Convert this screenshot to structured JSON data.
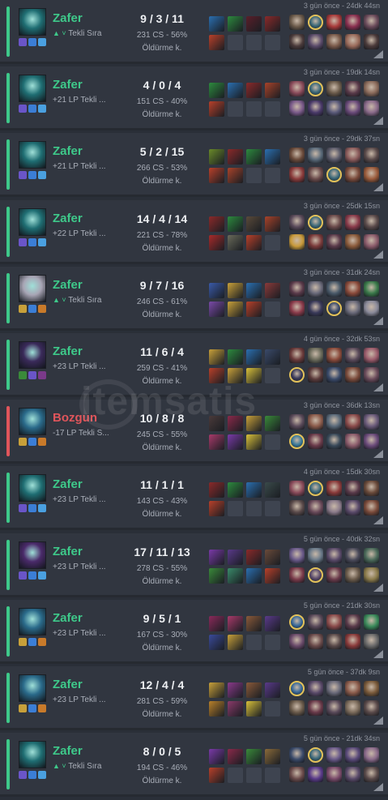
{
  "watermark": "itemsatis",
  "matches": [
    {
      "result": "Zafer",
      "outcome": "win",
      "lp": "Tekli Sıra",
      "lp_arrow": "▲ ˅",
      "kda": "9 / 3 / 11",
      "cs": "231 CS - 56%",
      "kill_streak": "Öldürme k.",
      "time": "3 gün önce - 24dk 44sn",
      "champ_color": "#1f6e73",
      "spells": [
        "#6a55c8",
        "#3b7ed6",
        "#4aa0e0"
      ],
      "items": [
        "#2b6fb0",
        "#2d8a3e",
        "#5a1f2a",
        "#8b2a2a",
        "#b8402a",
        "",
        "",
        ""
      ],
      "team": [
        "#6b5a4a",
        "#3d6a7a",
        "#a83a3a",
        "#8a3050",
        "#6a4a5a",
        "#4a3a3a",
        "#5a4a6a",
        "#7a5a4a",
        "#9a6a5a",
        "#4a3a3a"
      ],
      "me": 1
    },
    {
      "result": "Zafer",
      "outcome": "win",
      "lp": "+21 LP Tekli ...",
      "lp_arrow": "",
      "kda": "4 / 0 / 4",
      "cs": "151 CS - 40%",
      "kill_streak": "Öldürme k.",
      "time": "3 gün önce - 19dk 14sn",
      "champ_color": "#1f6e73",
      "spells": [
        "#6a55c8",
        "#3b7ed6",
        "#4aa0e0"
      ],
      "items": [
        "#2d8a3e",
        "#2b6fb0",
        "#8b2a2a",
        "#a8432a",
        "#b8402a",
        "",
        "",
        ""
      ],
      "team": [
        "#8a4a5a",
        "#3d6a7a",
        "#6a5a4a",
        "#5a3a4a",
        "#8a6a5a",
        "#7a5a8a",
        "#4a3a6a",
        "#5a5a7a",
        "#6a4a7a",
        "#8a6a8a"
      ],
      "me": 1
    },
    {
      "result": "Zafer",
      "outcome": "win",
      "lp": "+21 LP Tekli ...",
      "lp_arrow": "",
      "kda": "5 / 2 / 15",
      "cs": "266 CS - 53%",
      "kill_streak": "Öldürme k.",
      "time": "3 gün önce - 29dk 37sn",
      "champ_color": "#1f6e73",
      "spells": [
        "#6a55c8",
        "#3b7ed6",
        "#4aa0e0"
      ],
      "items": [
        "#6a8a2a",
        "#8b2a2a",
        "#2d8a3e",
        "#2b6fb0",
        "#b8402a",
        "#a8432a",
        "",
        ""
      ],
      "team": [
        "#6a4a3a",
        "#5a6a7a",
        "#5a5a6a",
        "#8a5a5a",
        "#5a4a4a",
        "#8a3a3a",
        "#6a4a4a",
        "#3d6a7a",
        "#7a4a3a",
        "#9a5a3a"
      ],
      "me": 7
    },
    {
      "result": "Zafer",
      "outcome": "win",
      "lp": "+22 LP Tekli ...",
      "lp_arrow": "",
      "kda": "14 / 4 / 14",
      "cs": "221 CS - 78%",
      "kill_streak": "Öldürme k.",
      "time": "3 gün önce - 25dk 15sn",
      "champ_color": "#1f6e73",
      "spells": [
        "#6a55c8",
        "#3b7ed6",
        "#4aa0e0"
      ],
      "items": [
        "#8b2a2a",
        "#2d8a3e",
        "#5a4a3a",
        "#a8432a",
        "#a82a2a",
        "#6a6a5a",
        "#b8402a",
        ""
      ],
      "team": [
        "#5a4a5a",
        "#3d6a7a",
        "#6a4a4a",
        "#8a3a4a",
        "#5a4a4a",
        "#c89a3a",
        "#7a3a3a",
        "#5a3a4a",
        "#8a5a3a",
        "#8a5a6a"
      ],
      "me": 1
    },
    {
      "result": "Zafer",
      "outcome": "win",
      "lp": "Tekli Sıra",
      "lp_arrow": "▲ ˅",
      "kda": "9 / 7 / 16",
      "cs": "246 CS - 61%",
      "kill_streak": "Öldürme k.",
      "time": "3 gün önce - 31dk 24sn",
      "champ_color": "#a8a5b5",
      "spells": [
        "#c8a03a",
        "#3b7ed6",
        "#c87a2a"
      ],
      "items": [
        "#3a5aa8",
        "#c8a03a",
        "#2b6fb0",
        "#8a3a3a",
        "#7a4aa8",
        "#c8a03a",
        "#b8402a",
        ""
      ],
      "team": [
        "#5a3a4a",
        "#6a6a7a",
        "#4a5a6a",
        "#8a4a3a",
        "#3a7a4a",
        "#8a3a4a",
        "#3a3a5a",
        "#3a4a6a",
        "#6a6a7a",
        "#8a8a9a"
      ],
      "me": 7
    },
    {
      "result": "Zafer",
      "outcome": "win",
      "lp": "+23 LP Tekli ...",
      "lp_arrow": "",
      "kda": "11 / 6 / 4",
      "cs": "259 CS - 41%",
      "kill_streak": "Öldürme k.",
      "time": "4 gün önce - 32dk 53sn",
      "champ_color": "#3a2a5a",
      "spells": [
        "#3a8a3a",
        "#6a55c8",
        "#7a3a8a"
      ],
      "items": [
        "#c8a03a",
        "#2d8a3e",
        "#2b6fb0",
        "#3a4a6a",
        "#b8402a",
        "#c8a03a",
        "#d8c03a",
        ""
      ],
      "team": [
        "#6a3a3a",
        "#6a6a5a",
        "#8a4a3a",
        "#5a4a5a",
        "#9a5a6a",
        "#3a3a5a",
        "#5a3a3a",
        "#3a4a6a",
        "#7a4a3a",
        "#6a4a5a"
      ],
      "me": 5
    },
    {
      "result": "Bozgun",
      "outcome": "loss",
      "lp": "-17 LP Tekli S...",
      "lp_arrow": "",
      "kda": "10 / 8 / 8",
      "cs": "245 CS - 55%",
      "kill_streak": "Öldürme k.",
      "time": "3 gün önce - 36dk 13sn",
      "champ_color": "#2a6a8a",
      "spells": [
        "#c8a03a",
        "#3b7ed6",
        "#c87a2a"
      ],
      "items": [
        "#4a3a3a",
        "#8a2a4a",
        "#c8a03a",
        "#3a8a3a",
        "#a83a6a",
        "#7a3aa8",
        "#d8c03a",
        ""
      ],
      "team": [
        "#5a4a5a",
        "#8a5a4a",
        "#5a6a7a",
        "#8a4a4a",
        "#6a5a7a",
        "#3a7a9a",
        "#6a3a4a",
        "#3a4a5a",
        "#8a5a6a",
        "#6a4a7a"
      ],
      "me": 5
    },
    {
      "result": "Zafer",
      "outcome": "win",
      "lp": "+23 LP Tekli ...",
      "lp_arrow": "",
      "kda": "11 / 1 / 1",
      "cs": "143 CS - 43%",
      "kill_streak": "Öldürme k.",
      "time": "4 gün önce - 15dk 30sn",
      "champ_color": "#1f6e73",
      "spells": [
        "#6a55c8",
        "#3b7ed6",
        "#4aa0e0"
      ],
      "items": [
        "#8b2a2a",
        "#2d8a3e",
        "#2b6fb0",
        "#3a4a4a",
        "#b8402a",
        "",
        "",
        ""
      ],
      "team": [
        "#8a4a5a",
        "#3d6a7a",
        "#8a3a3a",
        "#5a3a4a",
        "#6a4a3a",
        "#5a4a4a",
        "#6a4a5a",
        "#8a7a8a",
        "#5a4a6a",
        "#7a4a3a"
      ],
      "me": 1
    },
    {
      "result": "Zafer",
      "outcome": "win",
      "lp": "+23 LP Tekli ...",
      "lp_arrow": "",
      "kda": "17 / 11 / 13",
      "cs": "278 CS - 55%",
      "kill_streak": "Öldürme k.",
      "time": "5 gün önce - 40dk 32sn",
      "champ_color": "#4a2a6a",
      "spells": [
        "#6a55c8",
        "#3b7ed6",
        "#4aa0e0"
      ],
      "items": [
        "#7a3aa8",
        "#5a3a8a",
        "#8b2a2a",
        "#6a4a3a",
        "#3a8a3a",
        "#3a8a6a",
        "#2b6fb0",
        "#b8402a"
      ],
      "team": [
        "#6a5a8a",
        "#6a7a8a",
        "#5a4a6a",
        "#4a4a5a",
        "#4a6a5a",
        "#7a3a4a",
        "#5a4a6a",
        "#6a3a4a",
        "#6a5a4a",
        "#8a7a4a"
      ],
      "me": 6
    },
    {
      "result": "Zafer",
      "outcome": "win",
      "lp": "+23 LP Tekli ...",
      "lp_arrow": "",
      "kda": "9 / 5 / 1",
      "cs": "167 CS - 30%",
      "kill_streak": "Öldürme k.",
      "time": "5 gün önce - 21dk 30sn",
      "champ_color": "#2a6a8a",
      "spells": [
        "#c8a03a",
        "#3b7ed6",
        "#c87a2a"
      ],
      "items": [
        "#8a2a5a",
        "#a83a6a",
        "#8a5a3a",
        "#5a3a8a",
        "#3a4a9a",
        "#c8a03a",
        "",
        ""
      ],
      "team": [
        "#3a6a9a",
        "#5a4a5a",
        "#8a4a4a",
        "#5a3a4a",
        "#3a8a5a",
        "#6a4a6a",
        "#6a4a4a",
        "#5a4a4a",
        "#8a3a3a",
        "#6a6a6a"
      ],
      "me": 0
    },
    {
      "result": "Zafer",
      "outcome": "win",
      "lp": "+23 LP Tekli ...",
      "lp_arrow": "",
      "kda": "12 / 4 / 4",
      "cs": "281 CS - 59%",
      "kill_streak": "Öldürme k.",
      "time": "5 gün önce - 37dk 9sn",
      "champ_color": "#2a6a8a",
      "spells": [
        "#c8a03a",
        "#3b7ed6",
        "#c87a2a"
      ],
      "items": [
        "#c8a03a",
        "#8a3a8a",
        "#8a5a3a",
        "#5a3a8a",
        "#b8802a",
        "#8a3a6a",
        "#d8c03a",
        ""
      ],
      "team": [
        "#3a6a9a",
        "#5a4a6a",
        "#6a6a7a",
        "#8a5a4a",
        "#7a5a3a",
        "#6a5a4a",
        "#6a3a4a",
        "#5a4a5a",
        "#7a6a5a",
        "#5a4a4a"
      ],
      "me": 0
    },
    {
      "result": "Zafer",
      "outcome": "win",
      "lp": "Tekli Sıra",
      "lp_arrow": "▲ ˅",
      "kda": "8 / 0 / 5",
      "cs": "194 CS - 46%",
      "kill_streak": "Öldürme k.",
      "time": "5 gün önce - 21dk 34sn",
      "champ_color": "#1f6e73",
      "spells": [
        "#6a55c8",
        "#3b7ed6",
        "#4aa0e0"
      ],
      "items": [
        "#7a3aa8",
        "#8a2a4a",
        "#3a8a3a",
        "#8a6a3a",
        "#b8402a",
        "",
        "",
        ""
      ],
      "team": [
        "#3a4a6a",
        "#3d6a7a",
        "#6a5a8a",
        "#5a4a7a",
        "#8a6a8a",
        "#6a4a4a",
        "#5a3a8a",
        "#7a4a6a",
        "#5a4a6a",
        "#5a4a4a"
      ],
      "me": 1
    }
  ]
}
